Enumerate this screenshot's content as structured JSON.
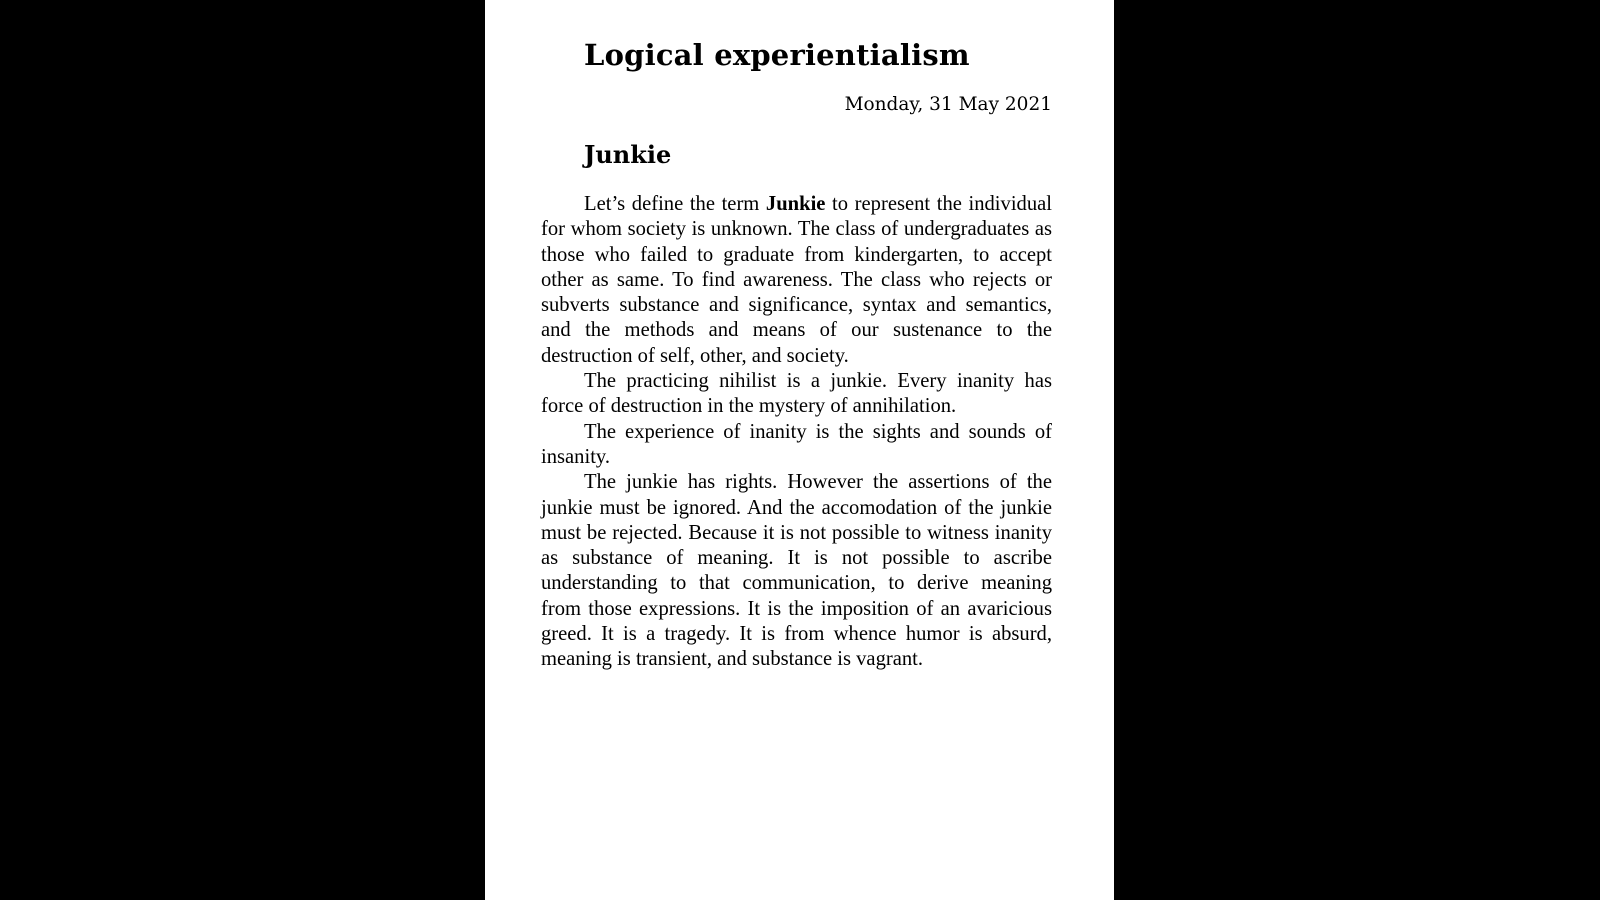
{
  "document": {
    "title": "Logical experientialism",
    "date": "Monday, 31 May 2021",
    "section": {
      "heading": "Junkie",
      "paragraphs": [
        {
          "lead": "Let’s define the term ",
          "term": "Junkie",
          "text": " to represent the individual for whom society is unknown. The class of undergraduates as those who failed to graduate from kindergarten, to accept other as same. To find awareness. The class who rejects or subverts substance and significance, syntax and semantics, and the methods and means of our sustenance to the destruction of self, other, and society."
        },
        {
          "text": "The practicing nihilist is a junkie. Every inanity has force of destruction in the mystery of annihilation."
        },
        {
          "text": "The experience of inanity is the sights and sounds of insanity."
        },
        {
          "text": "The junkie has rights. However the assertions of the junkie must be ignored. And the accomodation of the junkie must be rejected. Because it is not possible to witness inanity as substance of meaning. It is not possible to ascribe understanding to that communication, to derive meaning from those expressions. It is the imposition of an avaricious greed. It is a tragedy. It is from whence humor is absurd, meaning is transient, and substance is vagrant."
        }
      ]
    }
  }
}
